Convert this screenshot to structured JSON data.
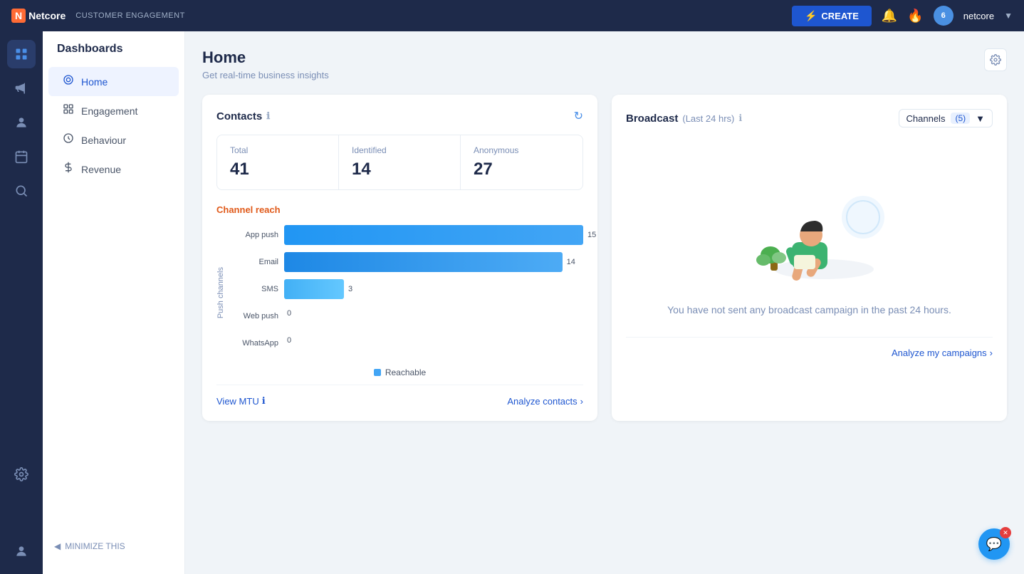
{
  "topnav": {
    "logo_n": "N",
    "logo_text": "Netcore",
    "customer_eng": "CUSTOMER ENGAGEMENT",
    "create_label": "CREATE",
    "notification_count": "",
    "badge_count": "6",
    "username": "netcore"
  },
  "sidebar": {
    "title": "Dashboards",
    "items": [
      {
        "id": "home",
        "label": "Home",
        "active": true
      },
      {
        "id": "engagement",
        "label": "Engagement",
        "active": false
      },
      {
        "id": "behaviour",
        "label": "Behaviour",
        "active": false
      },
      {
        "id": "revenue",
        "label": "Revenue",
        "active": false
      }
    ],
    "minimize": "MINIMIZE THIS"
  },
  "page": {
    "title": "Home",
    "subtitle": "Get real-time business insights"
  },
  "contacts_card": {
    "title": "Contacts",
    "stats": {
      "total_label": "Total",
      "total_value": "41",
      "identified_label": "Identified",
      "identified_value": "14",
      "anonymous_label": "Anonymous",
      "anonymous_value": "27"
    },
    "channel_reach_title": "Channel reach",
    "y_axis_label": "Push channels",
    "bars": [
      {
        "label": "App push",
        "value": 15,
        "max": 15,
        "pct": 100
      },
      {
        "label": "Email",
        "value": 14,
        "max": 15,
        "pct": 93
      },
      {
        "label": "SMS",
        "value": 3,
        "max": 15,
        "pct": 20
      },
      {
        "label": "Web push",
        "value": 0,
        "max": 15,
        "pct": 0
      },
      {
        "label": "WhatsApp",
        "value": 0,
        "max": 15,
        "pct": 0
      }
    ],
    "legend": "Reachable",
    "footer_left": "View MTU",
    "footer_right": "Analyze contacts"
  },
  "broadcast_card": {
    "title": "Broadcast",
    "subtitle": "Last 24 hrs",
    "channels_label": "Channels",
    "channels_count": "(5)",
    "empty_text": "You have not sent any broadcast campaign in the past 24 hours.",
    "footer_right": "Analyze my campaigns"
  }
}
